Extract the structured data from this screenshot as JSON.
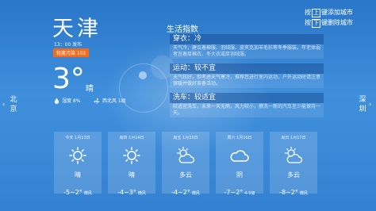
{
  "current": {
    "city": "天津",
    "update_time": "13：00 发布",
    "aqi": "轻度污染 102",
    "temperature": "3°",
    "condition": "晴",
    "humidity": "湿度 8%",
    "wind": "西北风 1级"
  },
  "navigation": {
    "prev_city": "北京",
    "next_city": "深圳",
    "left_arrow": "‹",
    "right_arrow": "›"
  },
  "hints": {
    "add_prefix": "按",
    "add_key": "上",
    "add_suffix": "键添加城市",
    "del_prefix": "按",
    "del_key": "下",
    "del_suffix": "键删除城市"
  },
  "life_index": {
    "title": "生活指数",
    "items": [
      {
        "label": "穿衣：冷",
        "detail": "天气冷，建议着棉服、羽绒服、皮夹克加羊毛衫等冬季服装。年老体弱者宜着厚棉衣、冬大衣或厚羽绒服。"
      },
      {
        "label": "运动：较不宜",
        "detail": "天气较好，但考虑天气寒冷，推荐您进行室内运动，户外运动时请注意保暖并做好准备活动。"
      },
      {
        "label": "洗车：较适宜",
        "detail": "较适宜洗车，未来一天无雨，风力较小，擦洗一新的汽车至少能保持一天。"
      }
    ]
  },
  "forecast": [
    {
      "date": "今天 1月13日",
      "condition": "晴",
      "temp": "-5~2°",
      "wind": "微风",
      "icon": "sun-icon"
    },
    {
      "date": "周四 1月14日",
      "condition": "晴",
      "temp": "-4~3°",
      "wind": "微风",
      "icon": "sun-icon"
    },
    {
      "date": "周五 1月15日",
      "condition": "多云",
      "temp": "-4~2°",
      "wind": "微风",
      "icon": "partly-cloudy-icon"
    },
    {
      "date": "周六 1月16日",
      "condition": "阴",
      "temp": "-7~2°",
      "wind": "4-5级",
      "icon": "cloud-icon"
    },
    {
      "date": "周日 1月17日",
      "condition": "多云",
      "temp": "-8~2°",
      "wind": "微风",
      "icon": "partly-cloudy-icon"
    }
  ]
}
